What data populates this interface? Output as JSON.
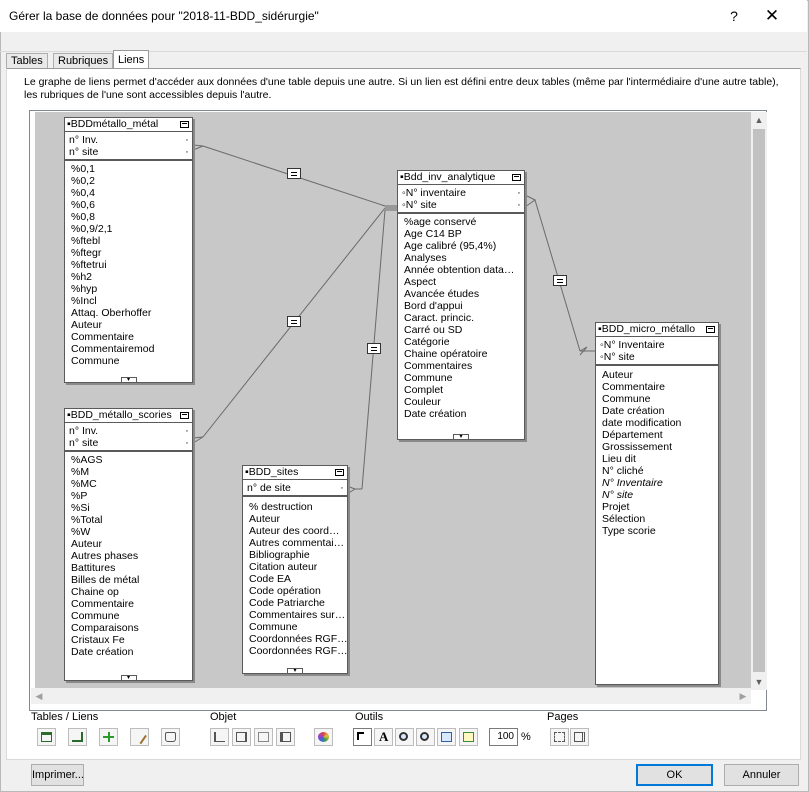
{
  "window": {
    "title": "Gérer la base de données pour \"2018-11-BDD_sidérurgie\"",
    "help_glyph": "?",
    "close_glyph": "✕"
  },
  "tabs": [
    {
      "label": "Tables"
    },
    {
      "label": "Rubriques"
    },
    {
      "label": "Liens"
    }
  ],
  "description": "Le graphe de liens permet d'accéder aux données d'une table depuis une autre. Si un lien est défini entre deux tables (même par l'intermédiaire d'une autre table), les rubriques de l'une sont accessibles depuis l'autre.",
  "tables": {
    "metal": {
      "name": "BDDmétallo_métal",
      "keys": [
        "n° Inv.",
        "n° site"
      ],
      "fields": [
        "%0,1",
        "%0,2",
        "%0,4",
        "%0,6",
        "%0,8",
        "%0,9/2,1",
        "%ftebl",
        "%ftegr",
        "%ftetrui",
        "%h2",
        "%hyp",
        "%Incl",
        "Attaq. Oberhoffer",
        "Auteur",
        "Commentaire",
        "Commentairemod",
        "Commune"
      ]
    },
    "scories": {
      "name": "BDD_métallo_scories",
      "keys": [
        "n° Inv.",
        "n° site"
      ],
      "fields": [
        "%AGS",
        "%M",
        "%MC",
        "%P",
        "%Si",
        "%Total",
        "%W",
        "Auteur",
        "Autres phases",
        "Battitures",
        "Billes de métal",
        "Chaine op",
        "Commentaire",
        "Commune",
        "Comparaisons",
        "Cristaux Fe",
        "Date création"
      ]
    },
    "sites": {
      "name": "BDD_sites",
      "keys": [
        "n° de site"
      ],
      "fields": [
        "% destruction",
        "Auteur",
        "Auteur des coord…",
        "Autres commentai…",
        "Bibliographie",
        "Citation auteur",
        "Code EA",
        "Code opération",
        "Code Patriarche",
        "Commentaires sur…",
        "Commune",
        "Coordonnées RGF…",
        "Coordonnées RGF…"
      ]
    },
    "analytique": {
      "name": "Bdd_inv_analytique",
      "keys": [
        "N° inventaire",
        "N° site"
      ],
      "fields": [
        "%age conservé",
        "Age C14 BP",
        "Age calibré (95,4%)",
        "Analyses",
        "Année obtention data…",
        "Aspect",
        "Avancée études",
        "Bord d'appui",
        "Caract. princic.",
        "Carré ou SD",
        "Catégorie",
        "Chaine opératoire",
        "Commentaires",
        "Commune",
        "Complet",
        "Couleur",
        "Date création"
      ]
    },
    "micro": {
      "name": "BDD_micro_métallo",
      "keys": [
        "N° Inventaire",
        "N° site"
      ],
      "fields": [
        "Auteur",
        "Commentaire",
        "Commune",
        "Date création",
        "date modification",
        "Département",
        "Grossissement",
        "Lieu dit",
        "N° cliché",
        "N° Inventaire",
        "N° site",
        "Projet",
        "Sélection",
        "Type scorie"
      ],
      "italic_fields": [
        "N° Inventaire",
        "N° site"
      ]
    }
  },
  "toolbar": {
    "tables_links_label": "Tables / Liens",
    "object_label": "Objet",
    "tools_label": "Outils",
    "pages_label": "Pages",
    "zoom_value": "100",
    "zoom_unit": "%",
    "text_tool_glyph": "A"
  },
  "buttons": {
    "print": "Imprimer...",
    "ok": "OK",
    "cancel": "Annuler"
  }
}
